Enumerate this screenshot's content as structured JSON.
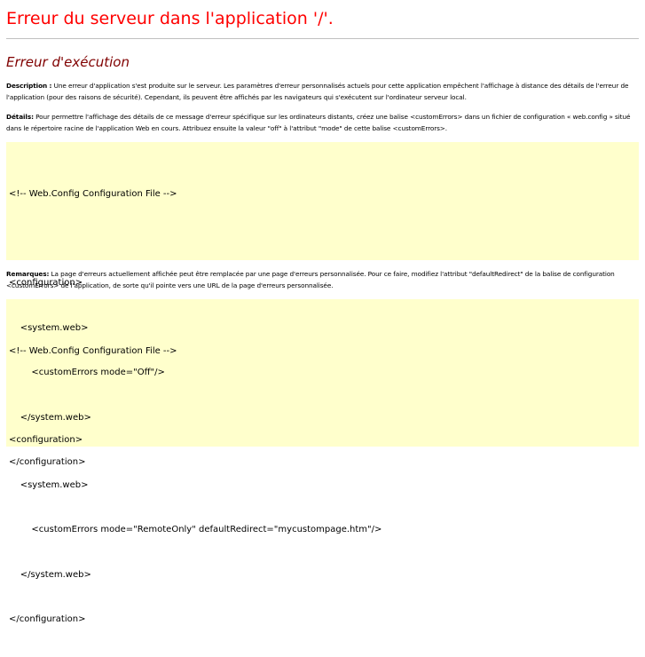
{
  "header": {
    "title": "Erreur du serveur dans l'application '/'."
  },
  "error": {
    "subtitle": "Erreur d'exécution",
    "description": {
      "label": "Description :",
      "text": " Une erreur d'application s'est produite sur le serveur. Les paramètres d'erreur personnalisés actuels pour cette application empêchent l'affichage à distance des détails de l'erreur de l'application (pour des raisons de sécurité). Cependant, ils peuvent être affichés par les navigateurs qui s'exécutent sur l'ordinateur serveur local."
    },
    "details": {
      "label": "Détails:",
      "text": " Pour permettre l'affichage des détails de ce message d'erreur spécifique sur les ordinateurs distants, créez une balise <customErrors> dans un fichier de configuration « web.config » situé dans le répertoire racine de l'application Web en cours. Attribuez ensuite la valeur \"off\" à l'attribut \"mode\" de cette balise <customErrors>."
    },
    "code1": {
      "lines": [
        "<!-- Web.Config Configuration File -->",
        "",
        "<configuration>",
        "    <system.web>",
        "        <customErrors mode=\"Off\"/>",
        "    </system.web>",
        "</configuration>"
      ]
    },
    "remarks": {
      "label": "Remarques:",
      "text": " La page d'erreurs actuellement affichée peut être remplacée par une page d'erreurs personnalisée. Pour ce faire, modifiez l'attribut \"defaultRedirect\" de la balise de configuration <customErrors> de l'application, de sorte qu'il pointe vers une URL de la page d'erreurs personnalisée."
    },
    "code2": {
      "lines": [
        "<!-- Web.Config Configuration File -->",
        "",
        "<configuration>",
        "    <system.web>",
        "        <customErrors mode=\"RemoteOnly\" defaultRedirect=\"mycustompage.htm\"/>",
        "    </system.web>",
        "</configuration>"
      ]
    }
  },
  "colors": {
    "title": "#ff0000",
    "subtitle": "#800000",
    "code_background": "#ffffcc",
    "rule": "#c0c0c0"
  }
}
